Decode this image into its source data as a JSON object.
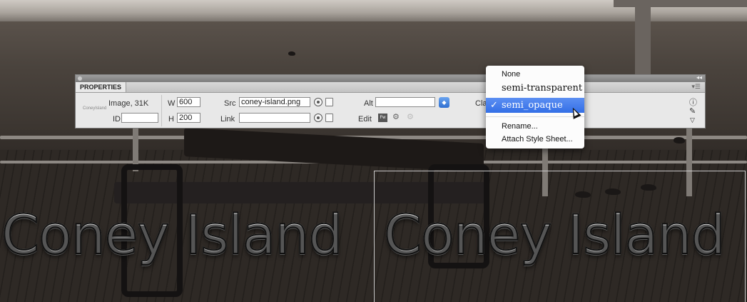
{
  "photo": {
    "title_left": "Coney Island",
    "title_right": "Coney Island"
  },
  "panel": {
    "tab": "PROPERTIES",
    "thumb_label": "ConeyIsland",
    "type_label": "Image, 31K",
    "id_label": "ID",
    "id_value": "",
    "w_label": "W",
    "w_value": "600",
    "h_label": "H",
    "h_value": "200",
    "src_label": "Src",
    "src_value": "coney-island.png",
    "link_label": "Link",
    "link_value": "",
    "alt_label": "Alt",
    "alt_value": "",
    "edit_label": "Edit",
    "fw_label": "Fw",
    "class_label_partial": "Cla"
  },
  "class_menu": {
    "items": [
      {
        "label": "None"
      },
      {
        "label": "semi-transparent"
      },
      {
        "label": "semi_opaque",
        "selected": true
      },
      {
        "label": "Rename..."
      },
      {
        "label": "Attach Style Sheet..."
      }
    ],
    "check": "✓"
  },
  "icons": [
    "point-to-file-icon",
    "browse-folder-icon",
    "fireworks-edit-icon",
    "edit-settings-icon",
    "resample-icon",
    "help-icon",
    "quick-tag-icon",
    "expand-icon",
    "panel-options-icon",
    "collapse-icon"
  ],
  "colors": {
    "menu_highlight": "#3a75e8",
    "panel_bg": "#e8e8e8"
  }
}
